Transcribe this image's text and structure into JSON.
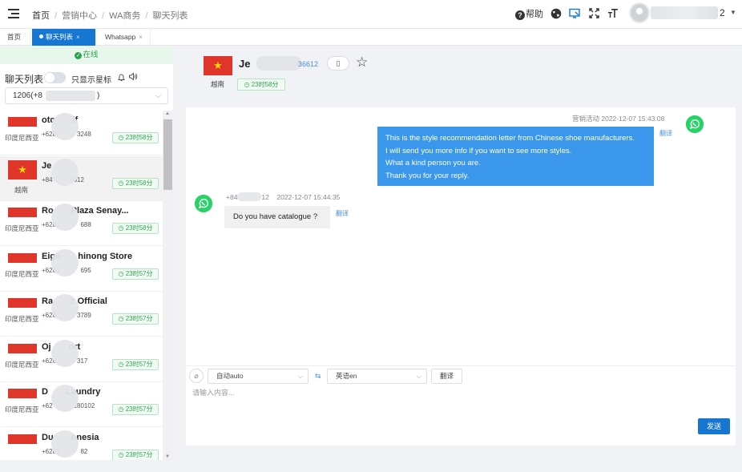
{
  "header": {
    "breadcrumb": [
      "首页",
      "营销中心",
      "WA商务",
      "聊天列表"
    ],
    "help_label": "帮助",
    "user_suffix": "2",
    "icons": [
      "menu-toggle-icon",
      "help-icon",
      "globe-icon",
      "screen-icon",
      "fullscreen-icon",
      "font-size-icon",
      "avatar",
      "chevron-down-icon"
    ]
  },
  "tabs": [
    {
      "label": "首页",
      "active": false,
      "closable": false
    },
    {
      "label": "聊天列表",
      "active": true,
      "closable": true
    },
    {
      "label": "Whatsapp",
      "active": false,
      "closable": true
    }
  ],
  "sidebar": {
    "online_status": "在线",
    "list_title": "聊天列表",
    "star_only_label": "只显示星标",
    "account_value": "1206(+8",
    "account_value_end": ")",
    "chats": [
      {
        "flag": "id",
        "country": "印度尼西亚",
        "name": "otc",
        "name_end": "if",
        "phone": "+628",
        "phone_end": "3248",
        "timer": "23时58分",
        "selected": false
      },
      {
        "flag": "vn",
        "country": "越南",
        "name": "Je",
        "name_end": "",
        "phone": "+84",
        "phone_end": "612",
        "timer": "23时58分",
        "selected": true
      },
      {
        "flag": "id",
        "country": "印度尼西亚",
        "name": "Ro",
        "name_end": "Plaza Senay...",
        "phone": "+6281",
        "phone_end": "688",
        "timer": "23时58分",
        "selected": false
      },
      {
        "flag": "id",
        "country": "印度尼西亚",
        "name": "Eige",
        "name_end": "hinong Store",
        "phone": "+6281",
        "phone_end": "695",
        "timer": "23时57分",
        "selected": false
      },
      {
        "flag": "id",
        "country": "印度尼西亚",
        "name": "Ra",
        "name_end": "z Official",
        "phone": "+628",
        "phone_end": "3789",
        "timer": "23时57分",
        "selected": false
      },
      {
        "flag": "id",
        "country": "印度尼西亚",
        "name": "Oj",
        "name_end": "ort",
        "phone": "+626",
        "phone_end": "317",
        "timer": "23时57分",
        "selected": false
      },
      {
        "flag": "id",
        "country": "印度尼西亚",
        "name": "D",
        "name_end": "Laundry",
        "phone": "+62",
        "phone_end": "180102",
        "timer": "23时57分",
        "selected": false
      },
      {
        "flag": "id",
        "country": "",
        "name": "Du",
        "name_end": "onesia",
        "phone": "+6281",
        "phone_end": "82",
        "timer": "23时57分",
        "selected": false
      }
    ]
  },
  "contact": {
    "flag": "vn",
    "country": "越南",
    "name": "Je",
    "phone_end": "36612",
    "timer": "23时58分"
  },
  "messages": {
    "outgoing": {
      "meta": "营销活动 2022-12-07 15:43:08",
      "lines": [
        "This is the style recommendation letter from Chinese shoe manufacturers.",
        "I will send you more info if you want to see more styles.",
        "What a kind person you are.",
        "Thank you for your reply."
      ],
      "translate": "翻译"
    },
    "incoming": {
      "phone_start": "+84",
      "phone_end": "12",
      "time": "2022-12-07 15:44:35",
      "text": "Do you have catalogue ?",
      "translate": "翻译"
    }
  },
  "composer": {
    "source_lang": "自动auto",
    "target_lang": "英语en",
    "translate_button": "翻译",
    "placeholder": "请输入内容...",
    "send_button": "发送"
  },
  "colors": {
    "primary": "#1677d2",
    "online_green": "#2fa44f",
    "whatsapp_green": "#25d366",
    "flag_red": "#e0352b",
    "bubble_blue": "#3a97ec"
  }
}
